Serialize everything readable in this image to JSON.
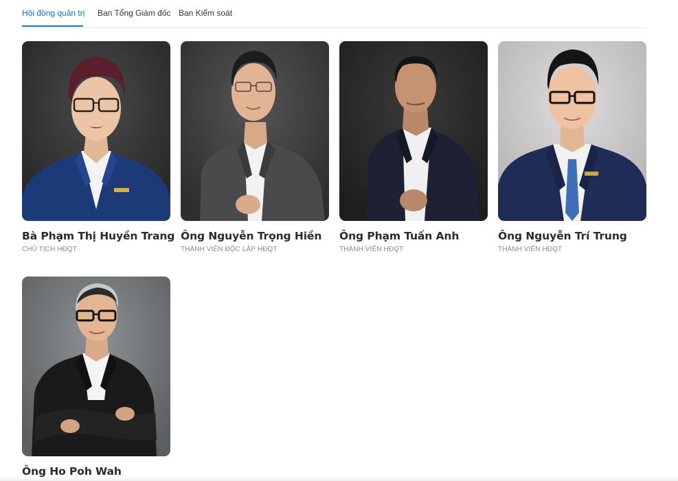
{
  "tabs": [
    {
      "label": "Hội đồng quản trị",
      "active": true
    },
    {
      "label": "Ban Tổng Giám đốc",
      "active": false
    },
    {
      "label": "Ban Kiểm soát",
      "active": false
    }
  ],
  "colors": {
    "accent": "#1a6fb5",
    "name_text": "#2b2b2b",
    "role_text": "#8a8a8a"
  },
  "members": [
    {
      "name": "Bà Phạm Thị Huyền Trang",
      "role": "CHỦ TỊCH HĐQT"
    },
    {
      "name": "Ông Nguyễn Trọng Hiền",
      "role": "THÀNH VIÊN ĐỘC LẬP HĐQT"
    },
    {
      "name": "Ông Phạm Tuấn Anh",
      "role": "THÀNH VIÊN HĐQT"
    },
    {
      "name": "Ông Nguyễn Trí Trung",
      "role": "THÀNH VIÊN HĐQT"
    },
    {
      "name": "Ông Ho Poh Wah",
      "role": ""
    }
  ]
}
